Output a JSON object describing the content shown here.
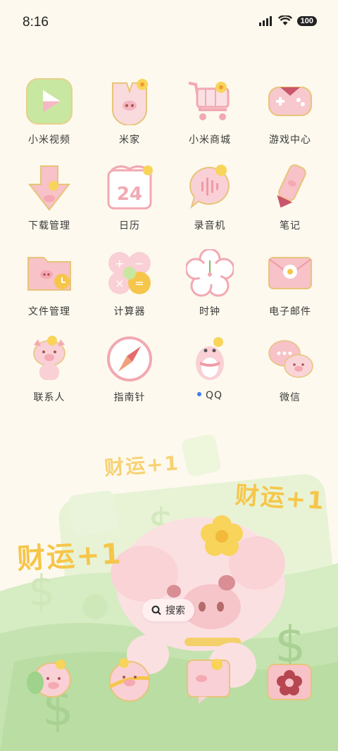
{
  "status": {
    "time": "8:16",
    "battery": "100"
  },
  "apps": [
    {
      "label": "小米视频",
      "icon": "play-video-icon"
    },
    {
      "label": "米家",
      "icon": "mijia-pig-icon"
    },
    {
      "label": "小米商城",
      "icon": "shopping-cart-icon"
    },
    {
      "label": "游戏中心",
      "icon": "gamepad-icon"
    },
    {
      "label": "下载管理",
      "icon": "download-arrow-icon"
    },
    {
      "label": "日历",
      "icon": "calendar-icon",
      "date": "24"
    },
    {
      "label": "录音机",
      "icon": "voice-recorder-icon"
    },
    {
      "label": "笔记",
      "icon": "pencil-notes-icon"
    },
    {
      "label": "文件管理",
      "icon": "folder-icon"
    },
    {
      "label": "计算器",
      "icon": "calculator-icon"
    },
    {
      "label": "时钟",
      "icon": "flower-clock-icon"
    },
    {
      "label": "电子邮件",
      "icon": "envelope-icon"
    },
    {
      "label": "联系人",
      "icon": "pig-contacts-icon"
    },
    {
      "label": "指南针",
      "icon": "compass-icon"
    },
    {
      "label": "QQ",
      "icon": "penguin-qq-icon",
      "has_update_dot": true
    },
    {
      "label": "微信",
      "icon": "wechat-bubbles-icon"
    }
  ],
  "search": {
    "label": "搜索"
  },
  "wallpaper": {
    "texts": [
      "财运+1",
      "财运+1",
      "财运+1"
    ]
  },
  "dock": [
    {
      "icon": "pig-phone-icon"
    },
    {
      "icon": "pig-browser-icon"
    },
    {
      "icon": "pig-message-icon"
    },
    {
      "icon": "flower-camera-icon"
    }
  ],
  "colors": {
    "background": "#fdf9ee",
    "pink": "#f7c9cc",
    "yellow": "#f6c64a",
    "green": "#c9e6b5"
  }
}
